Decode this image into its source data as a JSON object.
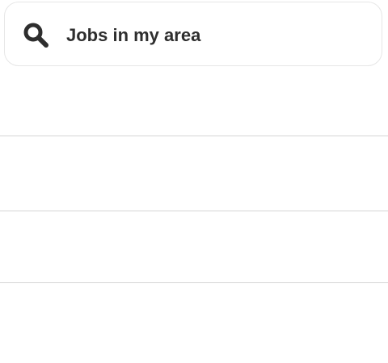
{
  "search": {
    "label": "Jobs in my area",
    "icon": "search-icon"
  },
  "list": {
    "rows": [
      {
        "label": ""
      },
      {
        "label": ""
      },
      {
        "label": ""
      }
    ]
  },
  "colors": {
    "text": "#2e2e2e",
    "icon": "#2e2e2e",
    "divider": "#d4d4d4",
    "search_border": "#e6e6e6",
    "background": "#ffffff"
  }
}
